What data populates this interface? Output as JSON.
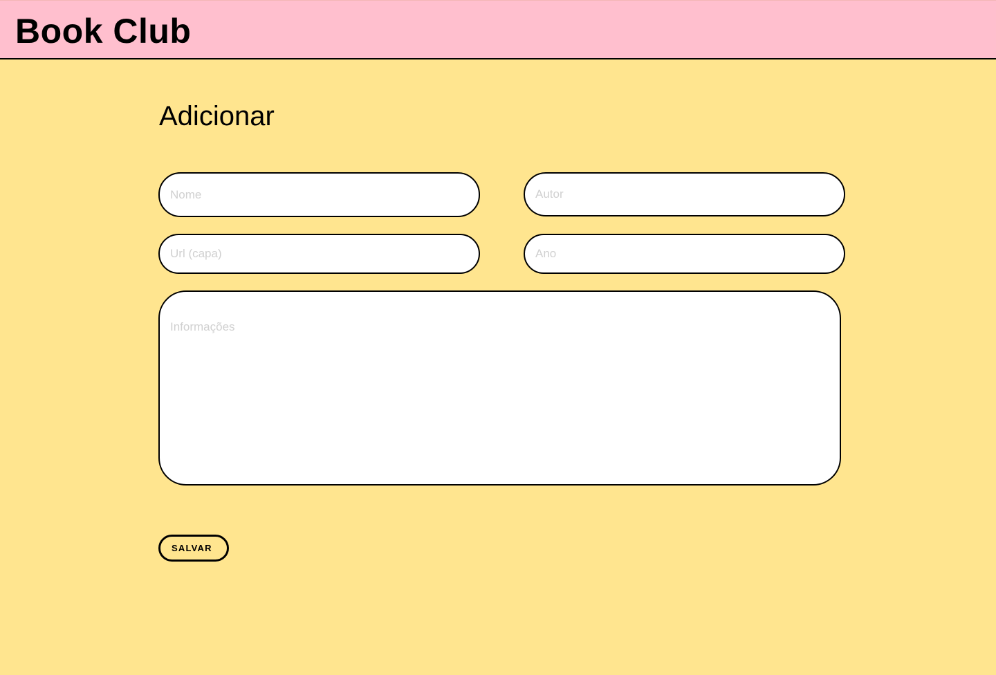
{
  "header": {
    "brand": "Book Club"
  },
  "main": {
    "title": "Adicionar"
  },
  "form": {
    "nome_placeholder": "Nome",
    "autor_placeholder": "Autor",
    "url_placeholder": "Url (capa)",
    "ano_placeholder": "Ano",
    "info_placeholder": "Informações",
    "nome_value": "",
    "autor_value": "",
    "url_value": "",
    "ano_value": "",
    "info_value": ""
  },
  "actions": {
    "save_label": "SALVAR"
  },
  "colors": {
    "header_bg": "#FFBFCE",
    "page_bg": "#FFE58F",
    "field_bg": "#FFFFFF",
    "border": "#000000",
    "placeholder": "#D0D0D0"
  }
}
